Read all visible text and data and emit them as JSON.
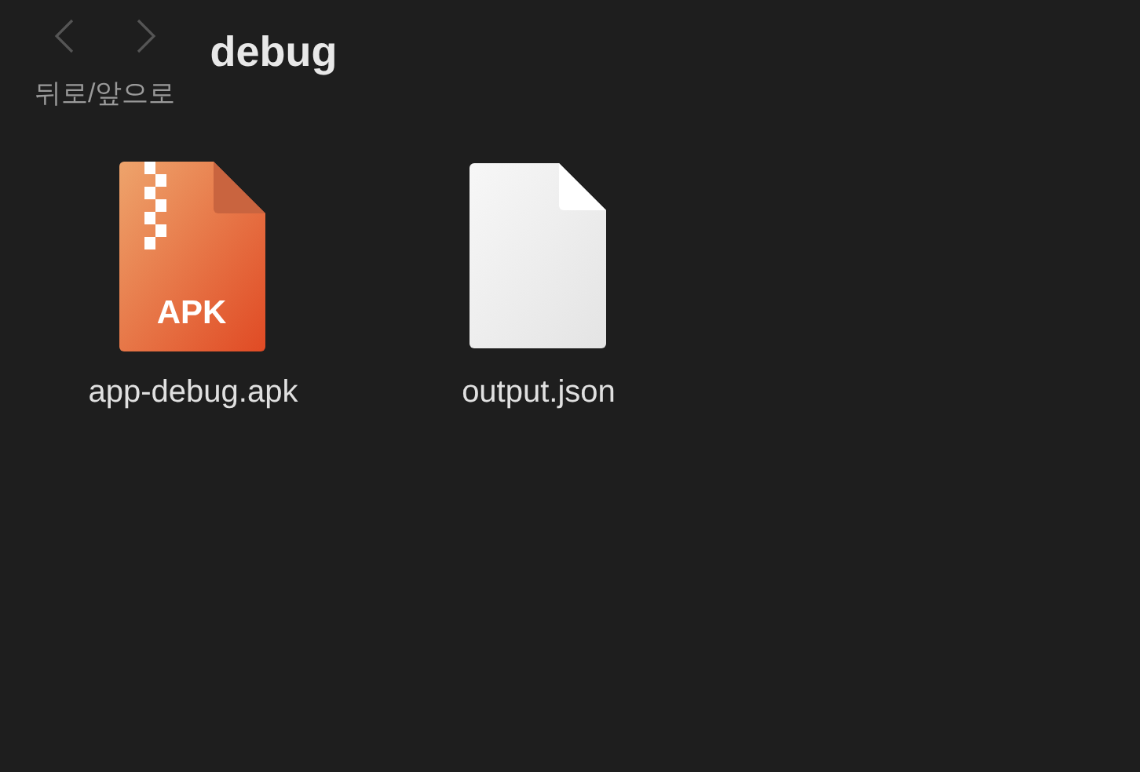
{
  "toolbar": {
    "nav_label": "뒤로/앞으로",
    "back_disabled": true,
    "forward_disabled": true
  },
  "window": {
    "title": "debug"
  },
  "files": [
    {
      "name": "app-debug.apk",
      "kind": "archive",
      "badge": "APK"
    },
    {
      "name": "output.json",
      "kind": "document"
    }
  ]
}
